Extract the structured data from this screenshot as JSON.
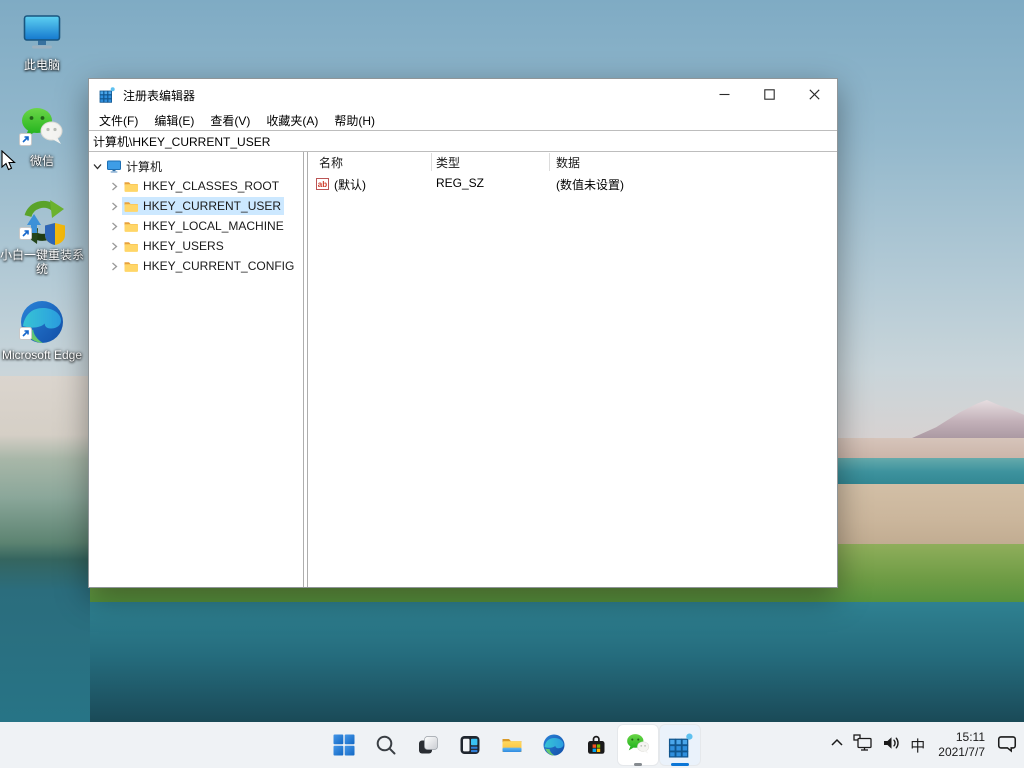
{
  "desktop": {
    "icons": [
      {
        "label": "此电脑",
        "shortcut": false
      },
      {
        "label": "微信",
        "shortcut": true
      },
      {
        "label": "小白一键重装系统",
        "shortcut": true
      },
      {
        "label": "Microsoft Edge",
        "shortcut": true
      }
    ]
  },
  "regedit": {
    "title": "注册表编辑器",
    "controls": [
      "minimize",
      "maximize",
      "close"
    ],
    "menu": [
      "文件(F)",
      "编辑(E)",
      "查看(V)",
      "收藏夹(A)",
      "帮助(H)"
    ],
    "address": "计算机\\HKEY_CURRENT_USER",
    "tree_root": "计算机",
    "tree_items": [
      {
        "label": "HKEY_CLASSES_ROOT",
        "selected": false
      },
      {
        "label": "HKEY_CURRENT_USER",
        "selected": true
      },
      {
        "label": "HKEY_LOCAL_MACHINE",
        "selected": false
      },
      {
        "label": "HKEY_USERS",
        "selected": false
      },
      {
        "label": "HKEY_CURRENT_CONFIG",
        "selected": false
      }
    ],
    "columns": [
      "名称",
      "类型",
      "数据"
    ],
    "rows": [
      {
        "name": "(默认)",
        "type": "REG_SZ",
        "data": "(数值未设置)"
      }
    ]
  },
  "taskbar": {
    "items": [
      "start",
      "search",
      "task-view",
      "widgets",
      "file-explorer",
      "edge",
      "store",
      "wechat",
      "registry-editor"
    ],
    "open_apps": [
      "wechat",
      "registry-editor"
    ],
    "active_app": "registry-editor",
    "tray_icons": [
      "chevron-up",
      "network",
      "volume",
      "ime",
      "clock",
      "notification"
    ],
    "ime": "中",
    "time": "15:11",
    "date": "2021/7/7"
  },
  "colors": {
    "selection": "#cce8ff",
    "taskbar_bg": "#eff2f5",
    "accent_blue": "#0c76d6",
    "wechat_green": "#3fbf2a",
    "folder_yellow": "#fcc84a"
  }
}
